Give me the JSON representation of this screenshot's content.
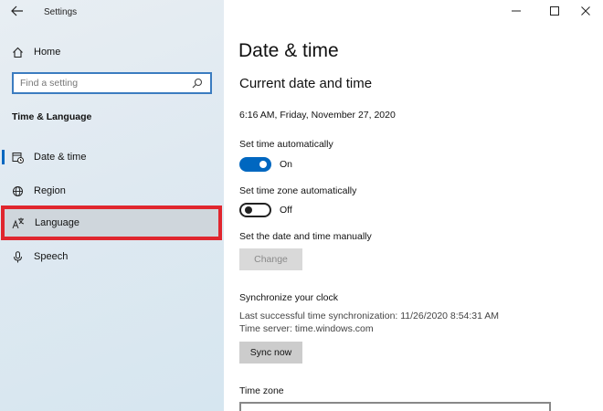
{
  "window": {
    "title": "Settings"
  },
  "sidebar": {
    "home_label": "Home",
    "search": {
      "placeholder": "Find a setting"
    },
    "section_title": "Time & Language",
    "items": [
      {
        "label": "Date & time",
        "icon": "calendar-clock-icon",
        "selected": true
      },
      {
        "label": "Region",
        "icon": "globe-icon",
        "selected": false
      },
      {
        "label": "Language",
        "icon": "language-icon",
        "selected": false,
        "highlighted": true
      },
      {
        "label": "Speech",
        "icon": "microphone-icon",
        "selected": false
      }
    ]
  },
  "main": {
    "page_title": "Date & time",
    "section_title": "Current date and time",
    "current_datetime": "6:16 AM, Friday, November 27, 2020",
    "set_time_auto": {
      "label": "Set time automatically",
      "state": "On",
      "on": true
    },
    "set_tz_auto": {
      "label": "Set time zone automatically",
      "state": "Off",
      "on": false
    },
    "manual": {
      "label": "Set the date and time manually",
      "button": "Change"
    },
    "sync": {
      "title": "Synchronize your clock",
      "last_sync": "Last successful time synchronization: 11/26/2020 8:54:31 AM",
      "server": "Time server: time.windows.com",
      "button": "Sync now"
    },
    "timezone_label": "Time zone"
  },
  "colors": {
    "accent": "#0067c0",
    "highlight_border": "#e0262e",
    "sidebar_bg": "#dfe9f1"
  }
}
